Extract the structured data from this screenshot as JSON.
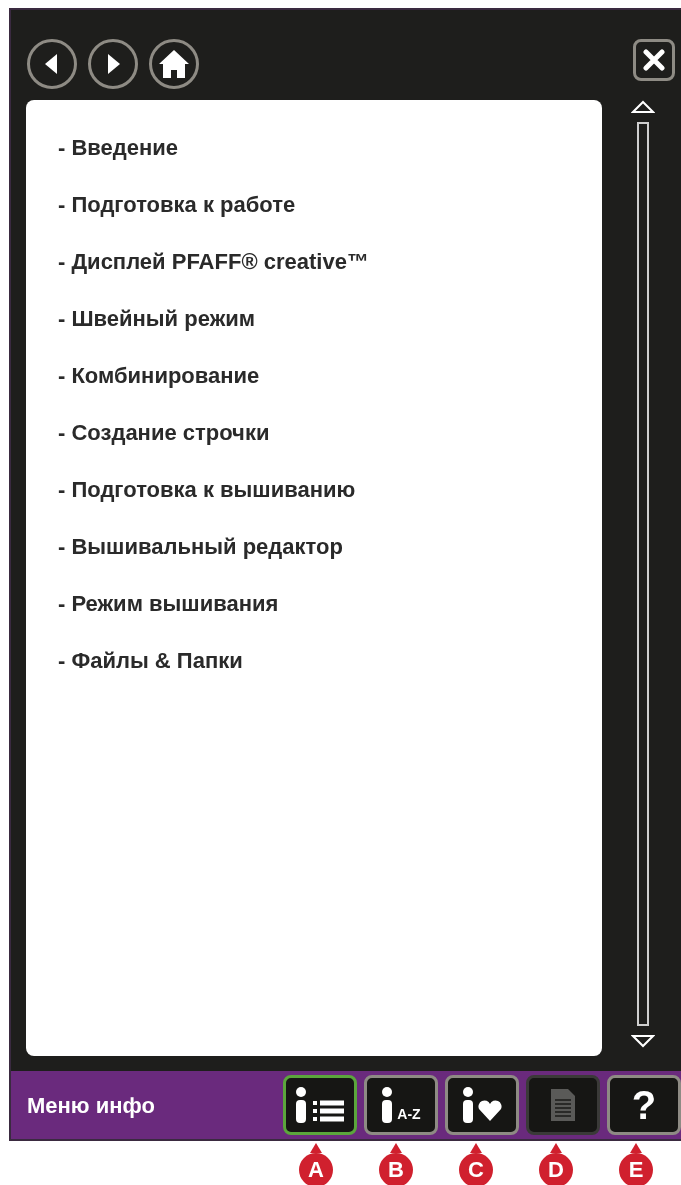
{
  "nav": {
    "buttons": [
      {
        "kind": "back"
      },
      {
        "kind": "forward"
      },
      {
        "kind": "home"
      }
    ]
  },
  "menu": {
    "items": [
      "- Введение",
      "- Подготовка к работе",
      "- Дисплей PFAFF® creative™",
      "- Швейный режим",
      "- Комбинирование",
      "- Создание строчки",
      "- Подготовка к вышиванию",
      "- Вышивальный редактор",
      "- Режим вышивания",
      "- Файлы & Папки"
    ]
  },
  "bottom_bar": {
    "title": "Меню инфо",
    "buttons": [
      {
        "kind": "contents",
        "selected": true,
        "disabled": false
      },
      {
        "kind": "index",
        "label": "A-Z",
        "selected": false,
        "disabled": false
      },
      {
        "kind": "favorites",
        "selected": false,
        "disabled": false
      },
      {
        "kind": "document",
        "selected": false,
        "disabled": true
      },
      {
        "kind": "help",
        "label": "?",
        "selected": false,
        "disabled": false
      }
    ]
  },
  "callouts": [
    "A",
    "B",
    "C",
    "D",
    "E"
  ]
}
